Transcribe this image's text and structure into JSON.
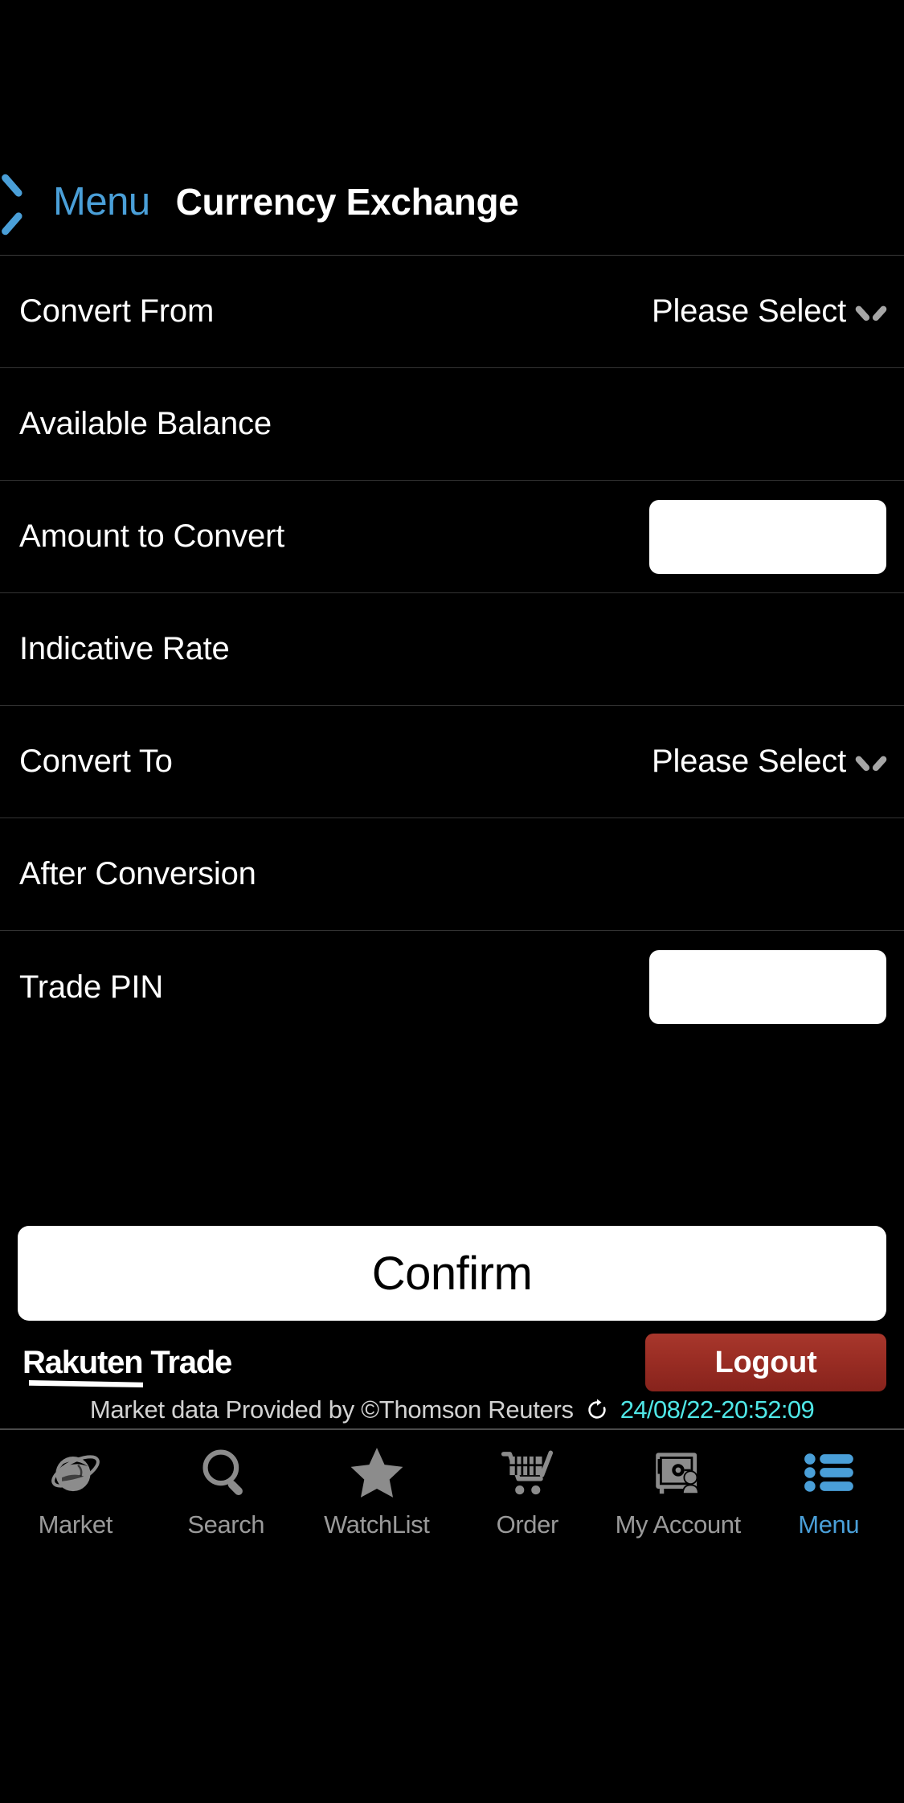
{
  "header": {
    "back_label": "Menu",
    "back_icon": "chevron-left-icon",
    "title": "Currency Exchange"
  },
  "form": {
    "rows": [
      {
        "label": "Convert From",
        "type": "select",
        "value": "Please Select",
        "icon": "chevron-down-icon"
      },
      {
        "label": "Available Balance",
        "type": "static",
        "value": ""
      },
      {
        "label": "Amount to Convert",
        "type": "input",
        "value": "",
        "placeholder": ""
      },
      {
        "label": "Indicative Rate",
        "type": "static",
        "value": ""
      },
      {
        "label": "Convert To",
        "type": "select",
        "value": "Please Select",
        "icon": "chevron-down-icon"
      },
      {
        "label": "After Conversion",
        "type": "static",
        "value": ""
      },
      {
        "label": "Trade PIN",
        "type": "input",
        "value": "",
        "placeholder": ""
      }
    ]
  },
  "actions": {
    "confirm_label": "Confirm",
    "logout_label": "Logout"
  },
  "brand": {
    "logo_text": "Rakuten Trade"
  },
  "footer": {
    "market_note": "Market data Provided by ©Thomson Reuters",
    "refresh_icon": "refresh-icon",
    "timestamp": "24/08/22-20:52:09"
  },
  "bottom_nav": {
    "items": [
      {
        "label": "Market",
        "icon": "globe-icon",
        "active": false
      },
      {
        "label": "Search",
        "icon": "search-icon",
        "active": false
      },
      {
        "label": "WatchList",
        "icon": "star-icon",
        "active": false
      },
      {
        "label": "Order",
        "icon": "cart-icon",
        "active": false
      },
      {
        "label": "My Account",
        "icon": "safe-icon",
        "active": false
      },
      {
        "label": "Menu",
        "icon": "list-menu-icon",
        "active": true
      }
    ]
  },
  "colors": {
    "background": "#000000",
    "accent_blue": "#4a9fd8",
    "logout_red": "#9a2d24",
    "timestamp_cyan": "#4fe6e6",
    "separator": "#333333",
    "nav_inactive": "#9a9a9a"
  }
}
